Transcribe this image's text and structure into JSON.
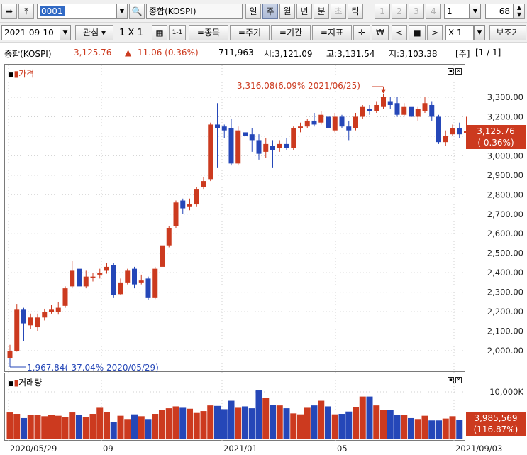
{
  "toolbar1": {
    "code_value": "0001",
    "index_name": "종합(KOSPI)",
    "periods": [
      "일",
      "주",
      "월",
      "년",
      "분",
      "초",
      "틱"
    ],
    "selected_period": "주",
    "pages": [
      "1",
      "2",
      "3",
      "4"
    ],
    "page_value": "1",
    "count_value": "68"
  },
  "toolbar2": {
    "date_value": "2021-09-10",
    "interest_label": "관심",
    "layout_label": "1 X 1",
    "small_grid_label": "1-1",
    "add_stock_label": "=종목",
    "add_period_label": "=주기",
    "add_term_label": "=기간",
    "add_indicator_label": "=지표",
    "multiplier_label": "X 1",
    "view_label": "보조기"
  },
  "infobar": {
    "name": "종합(KOSPI)",
    "price": "3,125.76",
    "change_arrow": "▲",
    "change": "11.06 (0.36%)",
    "volume": "711,963",
    "open": "시:3,121.09",
    "high": "고:3,131.54",
    "low": "저:3,103.38",
    "period": "[주]",
    "page": "[1 / 1]"
  },
  "price_panel": {
    "title": "가격",
    "high_annotation": "3,316.08(6.09% 2021/06/25)",
    "low_annotation": "1,967.84(-37.04% 2020/05/29)",
    "current_price_label": "3,125.76",
    "current_change_label": "( 0.36%)"
  },
  "volume_panel": {
    "title": "거래량",
    "tick_label": "10,000K",
    "current_volume_label": "3,985,569",
    "current_ratio_label": "(116.87%)"
  },
  "colors": {
    "up": "#cc3a1f",
    "down": "#2547b8",
    "annotation": "#cc3a1f",
    "annotation_low": "#2547b8"
  },
  "chart_data": {
    "type": "candlestick",
    "interval": "weekly",
    "y_ticks": [
      "2,000.00",
      "2,100.00",
      "2,200.00",
      "2,300.00",
      "2,400.00",
      "2,500.00",
      "2,600.00",
      "2,700.00",
      "2,800.00",
      "2,900.00",
      "3,000.00",
      "3,100.00",
      "3,200.00",
      "3,300.00"
    ],
    "ylim": [
      1920,
      3380
    ],
    "x_labels": [
      "2020/05/29",
      "09",
      "2021/01",
      "05",
      "2021/09/03"
    ],
    "candles": [
      [
        1960,
        2000,
        2030,
        1955
      ],
      [
        2000,
        2210,
        2240,
        1995
      ],
      [
        2210,
        2140,
        2220,
        2050
      ],
      [
        2130,
        2170,
        2190,
        2110
      ],
      [
        2120,
        2170,
        2190,
        2100
      ],
      [
        2170,
        2200,
        2215,
        2155
      ],
      [
        2200,
        2210,
        2235,
        2190
      ],
      [
        2200,
        2220,
        2250,
        2185
      ],
      [
        2230,
        2320,
        2330,
        2220
      ],
      [
        2330,
        2410,
        2460,
        2320
      ],
      [
        2420,
        2330,
        2450,
        2310
      ],
      [
        2330,
        2380,
        2410,
        2320
      ],
      [
        2380,
        2380,
        2400,
        2355
      ],
      [
        2390,
        2400,
        2420,
        2370
      ],
      [
        2410,
        2430,
        2450,
        2395
      ],
      [
        2440,
        2285,
        2450,
        2270
      ],
      [
        2290,
        2350,
        2370,
        2285
      ],
      [
        2350,
        2410,
        2420,
        2340
      ],
      [
        2420,
        2340,
        2430,
        2320
      ],
      [
        2350,
        2360,
        2390,
        2340
      ],
      [
        2370,
        2270,
        2380,
        2260
      ],
      [
        2270,
        2420,
        2430,
        2265
      ],
      [
        2430,
        2540,
        2550,
        2420
      ],
      [
        2540,
        2630,
        2640,
        2530
      ],
      [
        2640,
        2760,
        2770,
        2630
      ],
      [
        2770,
        2730,
        2780,
        2700
      ],
      [
        2740,
        2750,
        2780,
        2720
      ],
      [
        2750,
        2830,
        2840,
        2740
      ],
      [
        2840,
        2870,
        2890,
        2830
      ],
      [
        2880,
        3160,
        3170,
        2870
      ],
      [
        3160,
        3140,
        3270,
        2940
      ],
      [
        3150,
        3130,
        3160,
        3090
      ],
      [
        3140,
        2960,
        3190,
        2950
      ],
      [
        2960,
        3130,
        3150,
        2950
      ],
      [
        3120,
        3100,
        3150,
        3040
      ],
      [
        3110,
        3080,
        3140,
        3020
      ],
      [
        3080,
        3010,
        3110,
        2980
      ],
      [
        3020,
        3060,
        3090,
        2990
      ],
      [
        3050,
        3030,
        3080,
        2940
      ],
      [
        3040,
        3060,
        3080,
        3020
      ],
      [
        3060,
        3040,
        3090,
        3030
      ],
      [
        3040,
        3140,
        3150,
        3030
      ],
      [
        3140,
        3150,
        3170,
        3120
      ],
      [
        3150,
        3180,
        3190,
        3140
      ],
      [
        3180,
        3160,
        3220,
        3150
      ],
      [
        3170,
        3210,
        3230,
        3160
      ],
      [
        3200,
        3140,
        3240,
        3130
      ],
      [
        3130,
        3200,
        3220,
        3120
      ],
      [
        3200,
        3150,
        3210,
        3140
      ],
      [
        3150,
        3130,
        3180,
        3080
      ],
      [
        3140,
        3200,
        3220,
        3130
      ],
      [
        3200,
        3250,
        3260,
        3190
      ],
      [
        3240,
        3230,
        3260,
        3210
      ],
      [
        3230,
        3260,
        3280,
        3220
      ],
      [
        3250,
        3300,
        3316,
        3240
      ],
      [
        3280,
        3260,
        3300,
        3240
      ],
      [
        3270,
        3210,
        3300,
        3200
      ],
      [
        3210,
        3250,
        3270,
        3200
      ],
      [
        3250,
        3200,
        3270,
        3190
      ],
      [
        3200,
        3240,
        3250,
        3180
      ],
      [
        3230,
        3270,
        3300,
        3220
      ],
      [
        3260,
        3200,
        3280,
        3180
      ],
      [
        3200,
        3070,
        3210,
        3060
      ],
      [
        3070,
        3100,
        3130,
        3050
      ],
      [
        3110,
        3140,
        3160,
        3100
      ],
      [
        3140,
        3110,
        3170,
        3090
      ],
      [
        3115,
        3126,
        3200,
        3100
      ]
    ],
    "volumes": [
      5.6,
      5.3,
      4.4,
      5.1,
      5.1,
      4.8,
      5.0,
      4.9,
      4.6,
      5.6,
      5.0,
      4.6,
      5.3,
      6.6,
      5.7,
      3.5,
      4.9,
      4.2,
      5.2,
      4.8,
      4.2,
      5.3,
      6.1,
      6.5,
      6.9,
      6.6,
      6.4,
      5.5,
      5.9,
      7.1,
      7.0,
      6.3,
      8.1,
      6.6,
      6.9,
      6.5,
      10.3,
      8.7,
      7.2,
      7.1,
      6.5,
      5.4,
      5.2,
      6.6,
      7.1,
      8.1,
      6.9,
      5.2,
      5.3,
      5.8,
      6.7,
      9.0,
      9.0,
      7.1,
      6.1,
      6.1,
      5.0,
      5.1,
      4.4,
      4.2,
      4.9,
      3.9,
      3.9,
      4.3,
      4.8,
      3.98
    ]
  }
}
